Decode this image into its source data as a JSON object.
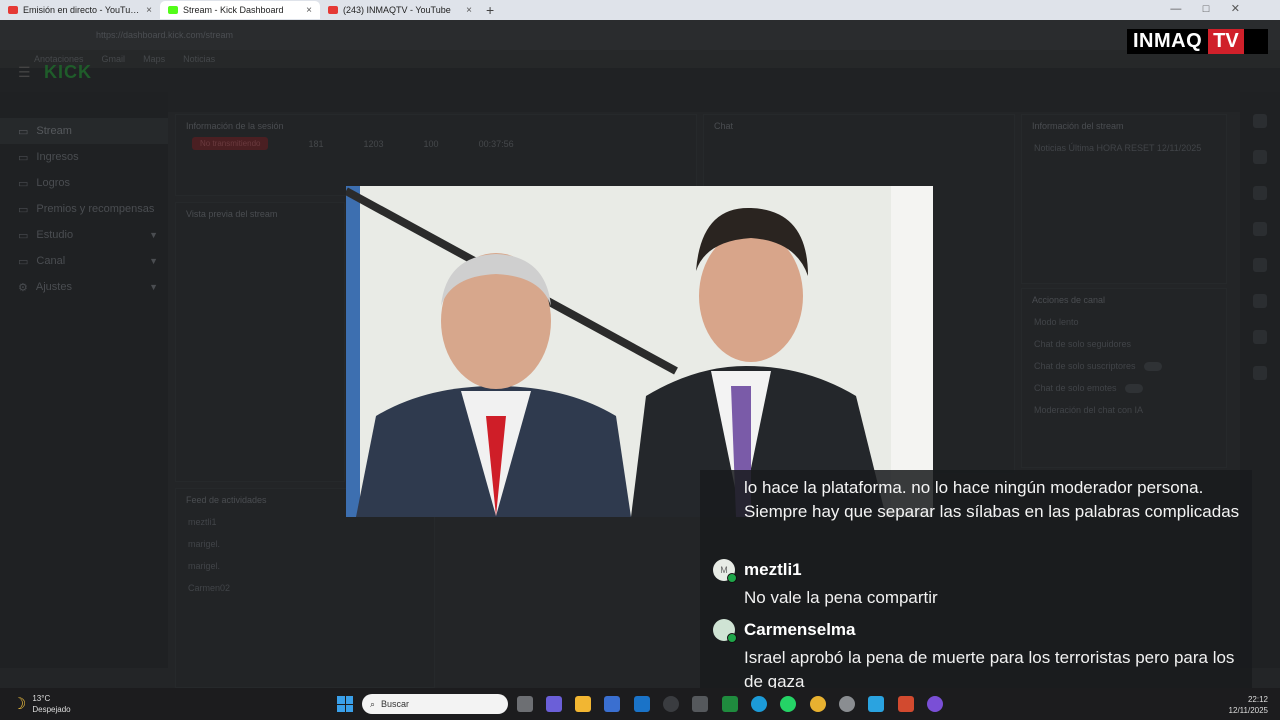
{
  "tabs": [
    {
      "title": "Emisión en directo - YouTube Stu",
      "color": "#e53935"
    },
    {
      "title": "Stream - Kick Dashboard",
      "color": "#53fc18"
    },
    {
      "title": "(243) INMAQTV - YouTube",
      "color": "#e53935"
    }
  ],
  "browser": {
    "url": "https://dashboard.kick.com/stream",
    "bookmarks": [
      "Anotaciones",
      "Gmail",
      "Maps",
      "Noticias"
    ]
  },
  "kick": {
    "logo": "KICK",
    "nav": [
      {
        "label": "Stream"
      },
      {
        "label": "Ingresos"
      },
      {
        "label": "Logros"
      },
      {
        "label": "Premios y recompensas"
      },
      {
        "label": "Estudio"
      },
      {
        "label": "Canal"
      },
      {
        "label": "Ajustes"
      }
    ],
    "session": {
      "title": "Información de la sesión",
      "status": "No transmitiendo",
      "viewers": "181",
      "followers": "1203",
      "subs": "100",
      "duration": "00:37:56"
    },
    "preview_title": "Vista previa del stream",
    "activity_title": "Feed de actividades",
    "activity": [
      "meztli1",
      "marigel.",
      "marigel.",
      "Carmen02"
    ],
    "chat_title": "Chat",
    "stream_info_title": "Información del stream",
    "stream_info_name": "Noticias Última HORA RESET 12/11/2025",
    "mod_title": "Acciones de canal",
    "mod_items": [
      "Modo lento",
      "Chat de solo seguidores",
      "Chat de solo suscriptores",
      "Chat de solo emotes",
      "Moderación del chat con IA"
    ]
  },
  "brand": {
    "word": "INMAQ",
    "tv": "TV"
  },
  "chat_overlay": {
    "continuation": "lo hace la plataforma. no lo hace ningún moderador persona. Siempre hay que separar las sílabas en las palabras complicadas",
    "messages": [
      {
        "user": "meztli1",
        "avatar_letter": "M",
        "text": "No vale la pena compartir"
      },
      {
        "user": "Carmenselma",
        "avatar_letter": "",
        "text": "Israel aprobó la pena de muerte para los terroristas pero para los de gaza"
      }
    ]
  },
  "taskbar": {
    "temp": "13°C",
    "weather": "Despejado",
    "search_placeholder": "Buscar",
    "time": "22:12",
    "date": "12/11/2025"
  }
}
